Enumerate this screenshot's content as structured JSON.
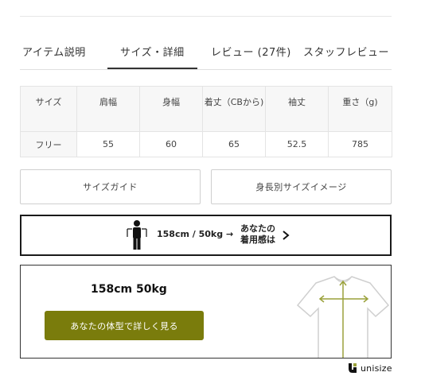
{
  "tabs": [
    {
      "label": "アイテム説明"
    },
    {
      "label": "サイズ・詳細"
    },
    {
      "label": "レビュー (27件)"
    },
    {
      "label": "スタッフレビュー"
    }
  ],
  "active_tab_index": 1,
  "size_table": {
    "headers": [
      "サイズ",
      "肩幅",
      "身幅",
      "着丈（CBから)",
      "袖丈",
      "重さ（g)"
    ],
    "rows": [
      [
        "フリー",
        "55",
        "60",
        "65",
        "52.5",
        "785"
      ]
    ]
  },
  "buttons": {
    "size_guide": "サイズガイド",
    "size_by_height": "身長別サイズイメージ"
  },
  "banner": {
    "measurement": "158cm / 50kg →",
    "cta_line1": "あなたの",
    "cta_line2": "着用感は"
  },
  "fit_box": {
    "measurement": "158cm 50kg",
    "button_label": "あなたの体型で詳しく見る"
  },
  "brand": {
    "name": "unisize",
    "accent_color": "#7a7c0c"
  }
}
